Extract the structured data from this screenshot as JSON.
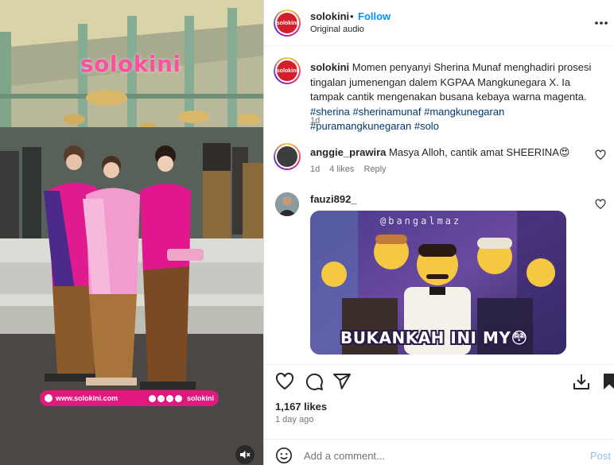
{
  "media": {
    "watermark": "solokini",
    "banner_site": "www.solokini.com",
    "banner_handle": "solokini",
    "mute_icon": "speaker-muted-icon"
  },
  "header": {
    "username": "solokini",
    "separator": "•",
    "follow_label": "Follow",
    "audio_label": "Original audio",
    "avatar_text": "solokini"
  },
  "caption": {
    "username": "solokini",
    "text": "Momen penyanyi Sherina Munaf menghadiri prosesi tingalan jumenengan dalem KGPAA Mangkunegara X. Ia tampak cantik mengenakan busana kebaya warna magenta.",
    "hashtags": [
      "#sherina",
      "#sherinamunaf",
      "#mangkunegaran",
      "#puramangkunegaran",
      "#solo"
    ],
    "time": "1d"
  },
  "comments": [
    {
      "username": "anggie_prawira",
      "text": "Masya Alloh, cantik amat SHEERINA",
      "emoji": "😍",
      "time": "1d",
      "likes": "4 likes",
      "reply_label": "Reply"
    },
    {
      "username": "fauzi892_",
      "gif_watermark": "@bangalmaz",
      "gif_caption": "BUKANKAH INI MY",
      "gif_emoji": "😳"
    }
  ],
  "actions": {
    "like_icon": "heart-icon",
    "comment_icon": "comment-icon",
    "share_icon": "share-icon",
    "download_icon": "download-icon",
    "save_icon": "bookmark-icon"
  },
  "stats": {
    "likes": "1,167 likes",
    "posted": "1 day ago"
  },
  "composer": {
    "placeholder": "Add a comment...",
    "post_label": "Post"
  },
  "colors": {
    "link_blue": "#0095f6",
    "hashtag": "#00376b",
    "muted": "#737373",
    "banner_pink": "#e0197f"
  }
}
